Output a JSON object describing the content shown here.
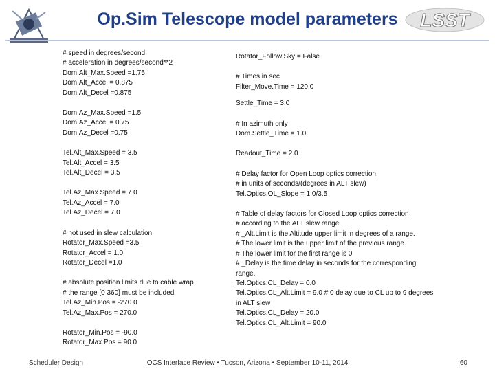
{
  "slide": {
    "title": "Op.Sim Telescope model parameters",
    "logo_text": "LSST"
  },
  "left_column": [
    [
      "# speed in degrees/second",
      "# acceleration in degrees/second**2",
      "Dom.Alt_Max.Speed =1.75",
      "Dom.Alt_Accel = 0.875",
      "Dom.Alt_Decel =0.875"
    ],
    [
      "Dom.Az_Max.Speed =1.5",
      "Dom.Az_Accel = 0.75",
      "Dom.Az_Decel =0.75"
    ],
    [
      "Tel.Alt_Max.Speed = 3.5",
      "Tel.Alt_Accel = 3.5",
      "Tel.Alt_Decel = 3.5"
    ],
    [
      "Tel.Az_Max.Speed = 7.0",
      "Tel.Az_Accel = 7.0",
      "Tel.Az_Decel = 7.0"
    ],
    [
      "# not used in slew calculation",
      "Rotator_Max.Speed =3.5",
      "Rotator_Accel = 1.0",
      "Rotator_Decel =1.0"
    ],
    [
      "# absolute position limits due to cable wrap",
      "# the range [0 360] must be included",
      "Tel.Az_Min.Pos = -270.0",
      "Tel.Az_Max.Pos = 270.0"
    ],
    [
      "Rotator_Min.Pos = -90.0",
      "Rotator_Max.Pos = 90.0"
    ]
  ],
  "right_column": [
    [
      "Rotator_Follow.Sky = False"
    ],
    [
      "# Times in sec",
      "Filter_Move.Time =     120.0"
    ],
    [
      "Settle_Time = 3.0"
    ],
    [
      "# In azimuth only",
      "Dom.Settle_Time = 1.0"
    ],
    [
      "Readout_Time = 2.0"
    ],
    [
      "# Delay factor for Open Loop optics correction,",
      "# in units of seconds/(degrees in ALT slew)",
      "Tel.Optics.OL_Slope = 1.0/3.5"
    ],
    [
      "# Table of delay factors for Closed Loop optics correction",
      "# according to the ALT slew range.",
      "# _Alt.Limit is the Altitude upper limit in degrees of a range.",
      "# The lower limit is the upper limit of the previous range.",
      "# The lower limit for the first range is 0",
      "# _Delay is the time delay in seconds for the corresponding",
      "range.",
      "Tel.Optics.CL_Delay   =   0.0",
      "Tel.Optics.CL_Alt.Limit =   9.0 # 0 delay due to CL up to 9 degrees",
      "in ALT slew",
      "Tel.Optics.CL_Delay   =  20.0",
      "Tel.Optics.CL_Alt.Limit =  90.0"
    ]
  ],
  "footer": {
    "left": "Scheduler Design",
    "center": "OCS Interface Review • Tucson, Arizona • September 10-11, 2014",
    "page": "60"
  },
  "colors": {
    "title": "#1f3f86",
    "rule": "#b9c4dd"
  }
}
